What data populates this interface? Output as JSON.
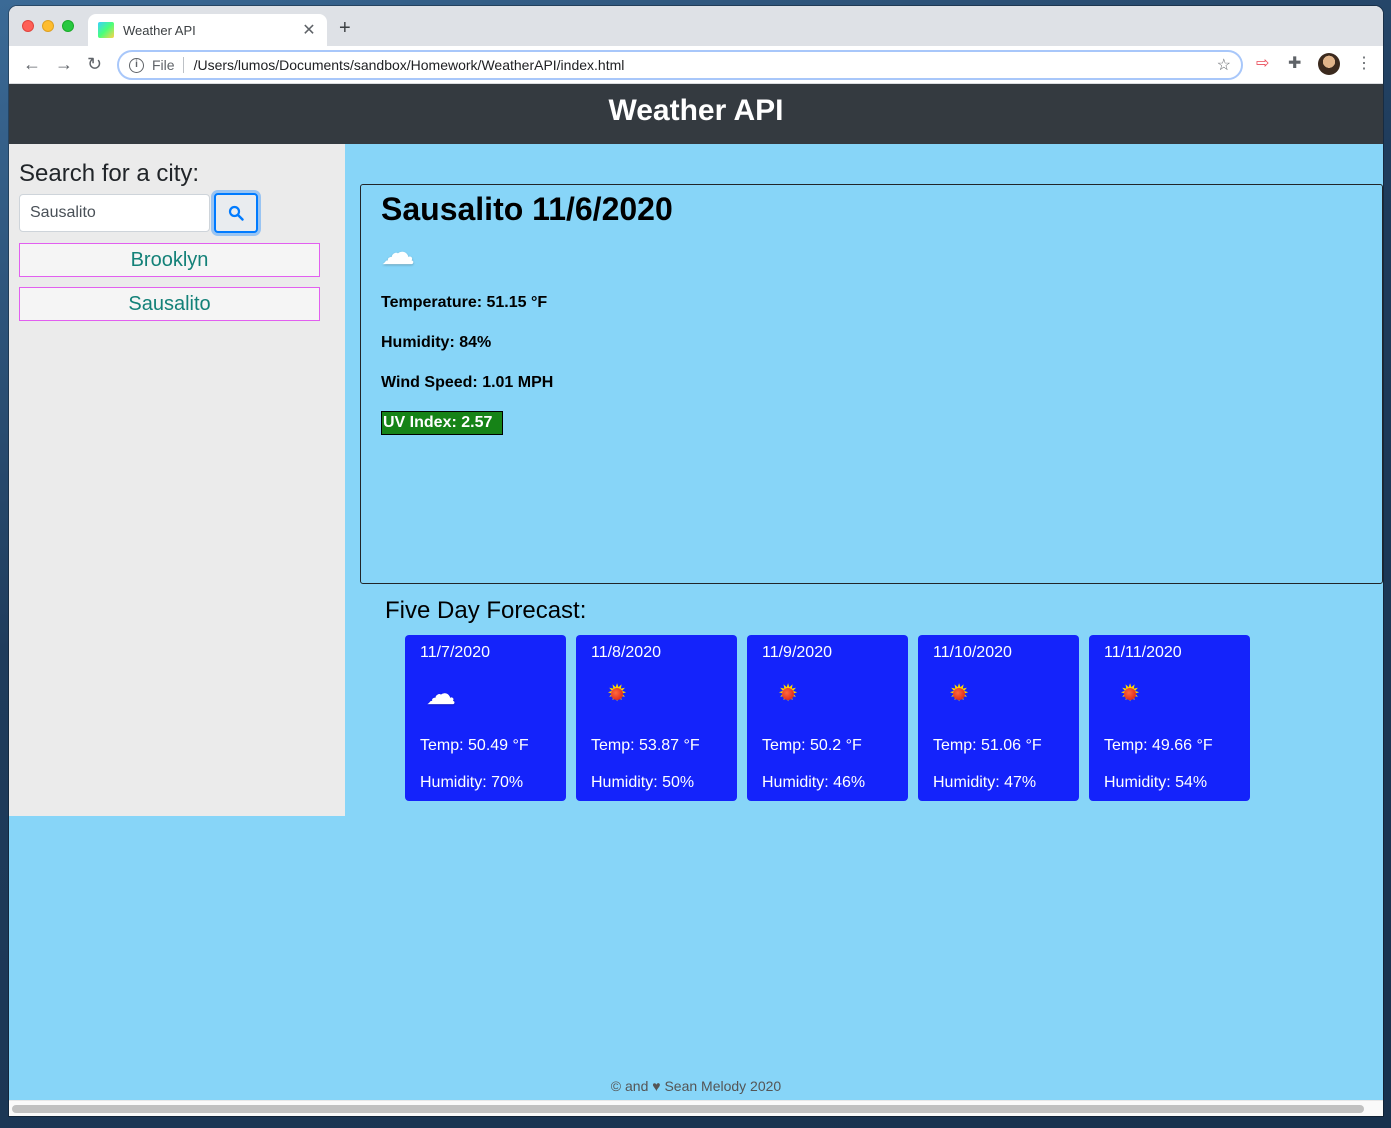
{
  "browser": {
    "tab_title": "Weather API",
    "file_label": "File",
    "url": "/Users/lumos/Documents/sandbox/Homework/WeatherAPI/index.html"
  },
  "header": {
    "title": "Weather API"
  },
  "sidebar": {
    "title": "Search for a city:",
    "search_value": "Sausalito",
    "history": [
      {
        "label": "Brooklyn"
      },
      {
        "label": "Sausalito"
      }
    ]
  },
  "current": {
    "title": "Sausalito 11/6/2020",
    "icon": "cloud-icon",
    "temperature": "Temperature: 51.15 °F",
    "humidity": "Humidity: 84%",
    "wind": "Wind Speed: 1.01 MPH",
    "uv": "UV Index: 2.57",
    "uv_color": "#168317"
  },
  "forecast": {
    "title": "Five Day Forecast:",
    "days": [
      {
        "date": "11/7/2020",
        "icon": "cloud-icon",
        "temp": "Temp: 50.49 °F",
        "humidity": "Humidity: 70%"
      },
      {
        "date": "11/8/2020",
        "icon": "sun-icon",
        "temp": "Temp: 53.87 °F",
        "humidity": "Humidity: 50%"
      },
      {
        "date": "11/9/2020",
        "icon": "sun-icon",
        "temp": "Temp: 50.2 °F",
        "humidity": "Humidity: 46%"
      },
      {
        "date": "11/10/2020",
        "icon": "sun-icon",
        "temp": "Temp: 51.06 °F",
        "humidity": "Humidity: 47%"
      },
      {
        "date": "11/11/2020",
        "icon": "sun-icon",
        "temp": "Temp: 49.66 °F",
        "humidity": "Humidity: 54%"
      }
    ]
  },
  "footer": {
    "text": "© and ♥ Sean Melody 2020"
  },
  "colors": {
    "header_bg": "#343a40",
    "page_bg": "#87d5f8",
    "card_bg": "#1423fb",
    "city_text": "#138178",
    "city_border": "#e25ff0"
  }
}
